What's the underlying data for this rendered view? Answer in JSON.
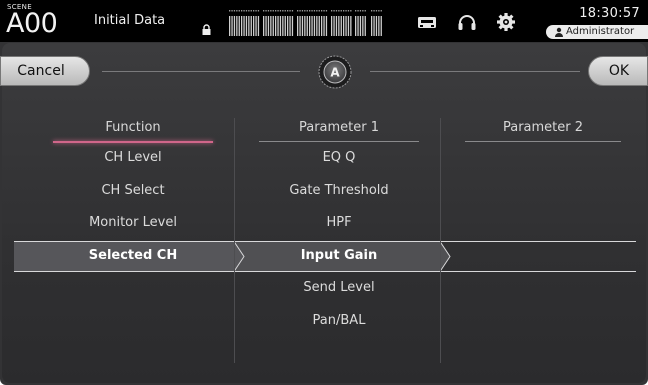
{
  "scene": {
    "label": "SCENE",
    "number": "A00",
    "name": "Initial Data"
  },
  "status": {
    "time": "18:30:57",
    "user": "Administrator"
  },
  "dialog": {
    "cancel_label": "Cancel",
    "ok_label": "OK",
    "badge": "A"
  },
  "columns": {
    "function": {
      "header": "Function",
      "items": [
        "CH Level",
        "CH Select",
        "Monitor Level",
        "Selected CH"
      ],
      "selected_index": 3
    },
    "param1": {
      "header": "Parameter 1",
      "items": [
        "EQ Q",
        "Gate Threshold",
        "HPF",
        "Input Gain",
        "Send Level",
        "Pan/BAL"
      ],
      "selected_index": 3
    },
    "param2": {
      "header": "Parameter 2",
      "items": []
    }
  },
  "colors": {
    "accent_function": "#d0668a",
    "panel": "#333335",
    "button": "#d6d6d6"
  },
  "icons": [
    "lock-icon",
    "level-meter-icon",
    "memory-card-icon",
    "headphones-icon",
    "gear-icon",
    "user-icon",
    "a-badge-icon"
  ]
}
